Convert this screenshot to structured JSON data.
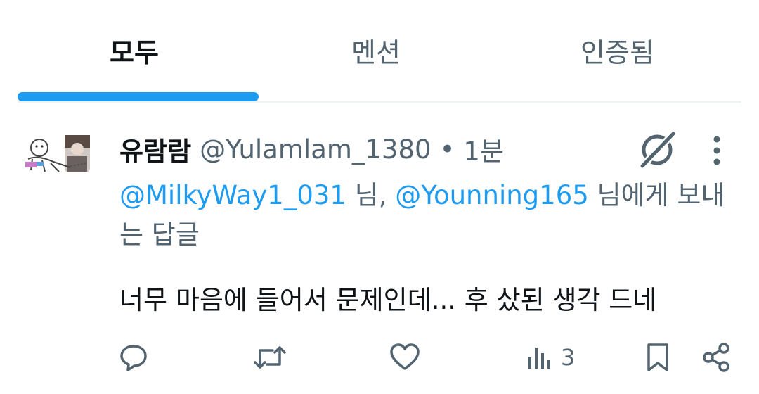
{
  "tabs": {
    "all": "모두",
    "mentions": "멘션",
    "verified": "인증됨",
    "active": "all"
  },
  "post": {
    "display_name": "유람람",
    "handle": "@Yulamlam_1380",
    "separator": "•",
    "time": "1분",
    "reply_to": {
      "mention1": "@MilkyWay1_031",
      "sep1": " 님, ",
      "mention2": "@Younning165",
      "suffix": " 님에게 보내는 답글"
    },
    "text": "너무 마음에 들어서 문제인데... 후 샀된 생각 드네",
    "views": "3"
  },
  "icons": {
    "grok": "grok-icon",
    "more": "more-vertical-icon",
    "reply": "reply-icon",
    "repost": "repost-icon",
    "like": "heart-icon",
    "views": "views-icon",
    "bookmark": "bookmark-icon",
    "share": "share-icon"
  },
  "colors": {
    "accent": "#1d9bf0",
    "text_primary": "#0f1419",
    "text_secondary": "#536471",
    "divider": "#eff3f4"
  }
}
